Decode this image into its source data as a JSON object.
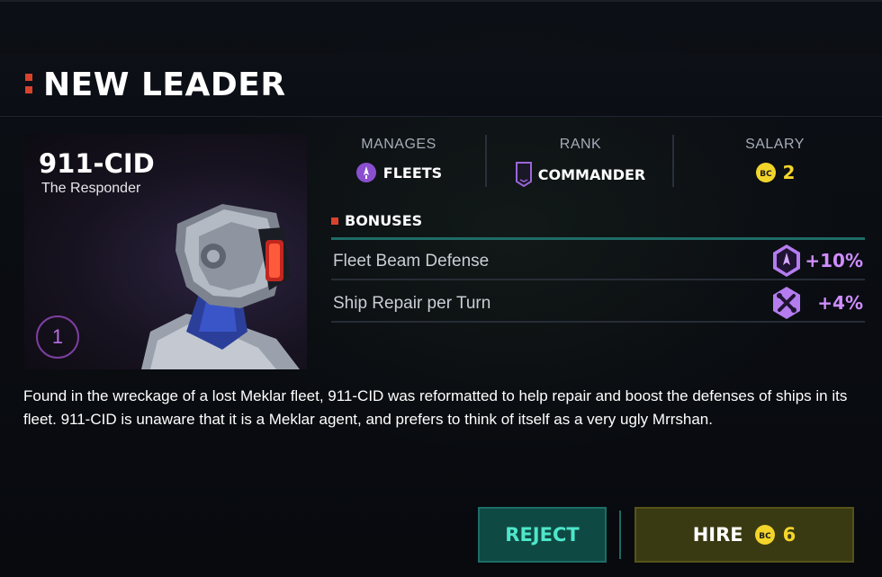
{
  "dialog": {
    "title": "NEW LEADER"
  },
  "leader": {
    "name": "911-CID",
    "subtitle": "The Responder",
    "level": "1"
  },
  "stats": {
    "manages": {
      "label": "MANAGES",
      "value": "FLEETS",
      "icon": "fleet-icon"
    },
    "rank": {
      "label": "RANK",
      "value": "COMMANDER",
      "icon": "rank-chevron-icon"
    },
    "salary": {
      "label": "SALARY",
      "value": "2",
      "icon": "bc-currency-icon",
      "icon_text": "BC"
    }
  },
  "bonuses": {
    "heading": "BONUSES",
    "items": [
      {
        "label": "Fleet Beam Defense",
        "value": "+10%",
        "icon": "beam-defense-hex-icon"
      },
      {
        "label": "Ship Repair per Turn",
        "value": "+4%",
        "icon": "repair-tools-hex-icon"
      }
    ]
  },
  "description": "Found in the wreckage of a lost Meklar fleet, 911-CID was reformatted to help repair and boost the defenses of ships in its fleet. 911-CID is unaware that it is a Meklar agent, and prefers to think of itself as a very ugly Mrrshan.",
  "actions": {
    "reject_label": "REJECT",
    "hire_label": "HIRE",
    "hire_cost": "6",
    "hire_icon_text": "BC"
  },
  "colors": {
    "accent_red": "#d9432c",
    "bonus_purple": "#cf8dff",
    "currency_yellow": "#f3d52a",
    "reject_teal": "#4fe6c9"
  }
}
